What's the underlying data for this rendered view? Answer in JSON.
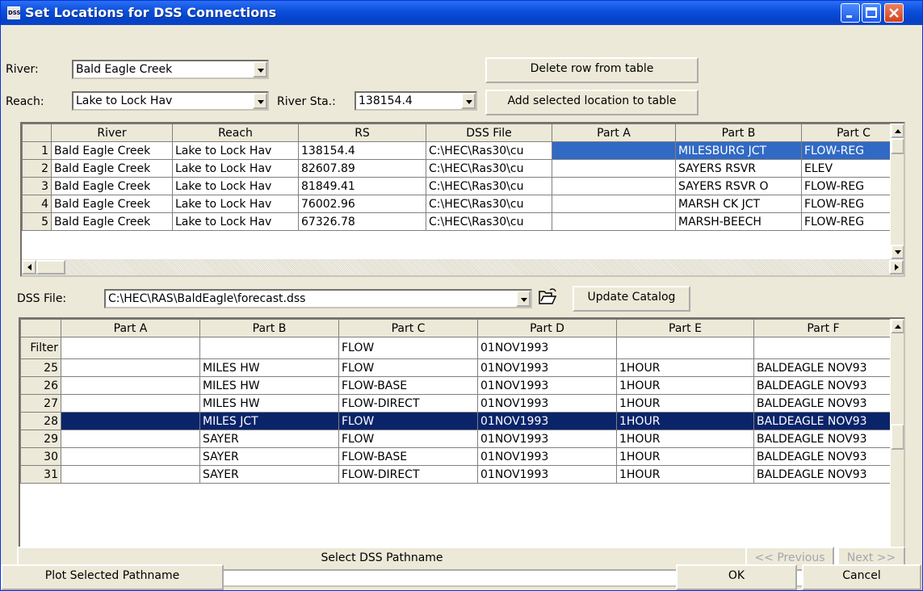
{
  "window": {
    "title": "Set Locations for DSS Connections",
    "app_icon_text": "DSS",
    "colors": {
      "titlebar": "#0a4ddb",
      "selection": "#0a246a",
      "cell_highlight": "#316ac5"
    }
  },
  "form": {
    "river_label": "River:",
    "river_value": "Bald Eagle Creek",
    "reach_label": "Reach:",
    "reach_value": "Lake to Lock Hav",
    "station_label": "River Sta.:",
    "station_value": "138154.4",
    "delete_row_label": "Delete row from table",
    "add_location_label": "Add selected location to table"
  },
  "locations": {
    "columns": [
      "River",
      "Reach",
      "RS",
      "DSS File",
      "Part A",
      "Part B",
      "Part C"
    ],
    "rows": [
      {
        "num": "1",
        "river": "Bald Eagle Creek",
        "reach": "Lake to Lock Hav",
        "rs": "138154.4",
        "dss_file": "C:\\HEC\\Ras30\\cu",
        "part_a": "",
        "part_b": "MILESBURG JCT",
        "part_c": "FLOW-REG"
      },
      {
        "num": "2",
        "river": "Bald Eagle Creek",
        "reach": "Lake to Lock Hav",
        "rs": "82607.89",
        "dss_file": "C:\\HEC\\Ras30\\cu",
        "part_a": "",
        "part_b": "SAYERS RSVR",
        "part_c": "ELEV"
      },
      {
        "num": "3",
        "river": "Bald Eagle Creek",
        "reach": "Lake to Lock Hav",
        "rs": "81849.41",
        "dss_file": "C:\\HEC\\Ras30\\cu",
        "part_a": "",
        "part_b": "SAYERS RSVR O",
        "part_c": "FLOW-REG"
      },
      {
        "num": "4",
        "river": "Bald Eagle Creek",
        "reach": "Lake to Lock Hav",
        "rs": "76002.96",
        "dss_file": "C:\\HEC\\Ras30\\cu",
        "part_a": "",
        "part_b": "MARSH CK JCT",
        "part_c": "FLOW-REG"
      },
      {
        "num": "5",
        "river": "Bald Eagle Creek",
        "reach": "Lake to Lock Hav",
        "rs": "67326.78",
        "dss_file": "C:\\HEC\\Ras30\\cu",
        "part_a": "",
        "part_b": "MARSH-BEECH",
        "part_c": "FLOW-REG"
      }
    ]
  },
  "dss": {
    "file_label": "DSS File:",
    "file_value": "C:\\HEC\\RAS\\BaldEagle\\forecast.dss",
    "update_catalog_label": "Update Catalog"
  },
  "catalog": {
    "columns": [
      "Part A",
      "Part B",
      "Part C",
      "Part D",
      "Part E",
      "Part F"
    ],
    "filter": {
      "label": "Filter",
      "part_a": "",
      "part_b": "",
      "part_c": "FLOW",
      "part_d": "01NOV1993",
      "part_e": "",
      "part_f": ""
    },
    "rows": [
      {
        "num": "25",
        "part_a": "",
        "part_b": "MILES HW",
        "part_c": "FLOW",
        "part_d": "01NOV1993",
        "part_e": "1HOUR",
        "part_f": "BALDEAGLE NOV93"
      },
      {
        "num": "26",
        "part_a": "",
        "part_b": "MILES HW",
        "part_c": "FLOW-BASE",
        "part_d": "01NOV1993",
        "part_e": "1HOUR",
        "part_f": "BALDEAGLE NOV93"
      },
      {
        "num": "27",
        "part_a": "",
        "part_b": "MILES HW",
        "part_c": "FLOW-DIRECT",
        "part_d": "01NOV1993",
        "part_e": "1HOUR",
        "part_f": "BALDEAGLE NOV93"
      },
      {
        "num": "28",
        "part_a": "",
        "part_b": "MILES JCT",
        "part_c": "FLOW",
        "part_d": "01NOV1993",
        "part_e": "1HOUR",
        "part_f": "BALDEAGLE NOV93"
      },
      {
        "num": "29",
        "part_a": "",
        "part_b": "SAYER",
        "part_c": "FLOW",
        "part_d": "01NOV1993",
        "part_e": "1HOUR",
        "part_f": "BALDEAGLE NOV93"
      },
      {
        "num": "30",
        "part_a": "",
        "part_b": "SAYER",
        "part_c": "FLOW-BASE",
        "part_d": "01NOV1993",
        "part_e": "1HOUR",
        "part_f": "BALDEAGLE NOV93"
      },
      {
        "num": "31",
        "part_a": "",
        "part_b": "SAYER",
        "part_c": "FLOW-DIRECT",
        "part_d": "01NOV1993",
        "part_e": "1HOUR",
        "part_f": "BALDEAGLE NOV93"
      }
    ]
  },
  "footer": {
    "select_pathname_label": "Select DSS Pathname",
    "previous_label": "<< Previous",
    "next_label": "Next >>",
    "plot_label": "Plot Selected Pathname",
    "ok_label": "OK",
    "cancel_label": "Cancel"
  }
}
